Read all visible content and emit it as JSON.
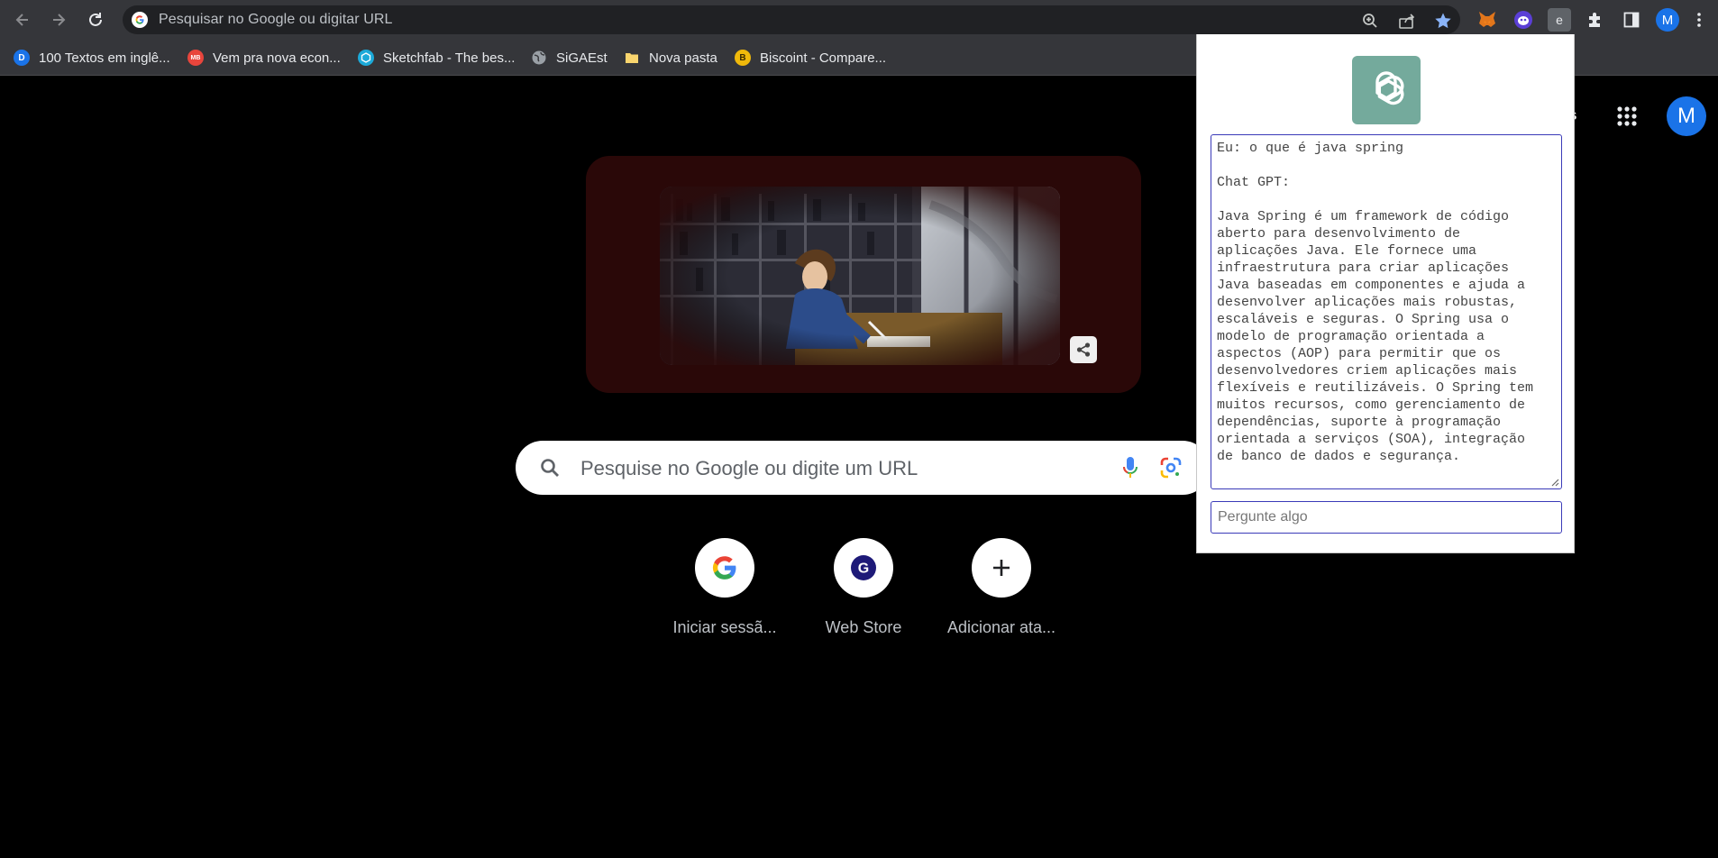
{
  "toolbar": {
    "omnibox_placeholder": "Pesquisar no Google ou digitar URL",
    "account_initial": "M"
  },
  "bookmarks": [
    {
      "label": "100 Textos em inglê...",
      "icon": "D",
      "color": "#1a73e8"
    },
    {
      "label": "Vem pra nova econ...",
      "icon": "MB",
      "color": "#e8453c"
    },
    {
      "label": "Sketchfab - The bes...",
      "icon": "sketchfab-icon",
      "color": "#1caad9"
    },
    {
      "label": "SiGAEst",
      "icon": "globe-icon",
      "color": "#9aa0a6"
    },
    {
      "label": "Nova pasta",
      "icon": "folder-icon",
      "color": "#f9d56e"
    },
    {
      "label": "Biscoint - Compare...",
      "icon": "B",
      "color": "#f0b90b"
    }
  ],
  "ntp": {
    "header_link_fragment": "s",
    "account_initial": "M",
    "search_placeholder": "Pesquise no Google ou digite um URL",
    "shortcuts": [
      {
        "label": "Iniciar sessã...",
        "icon": "google-g-icon"
      },
      {
        "label": "Web Store",
        "icon": "web-store-icon"
      },
      {
        "label": "Adicionar ata...",
        "icon": "plus-icon"
      }
    ]
  },
  "popup": {
    "chat_text": "Eu: o que é java spring\n\nChat GPT:\n\nJava Spring é um framework de código\naberto para desenvolvimento de\naplicações Java. Ele fornece uma\ninfraestrutura para criar aplicações\nJava baseadas em componentes e ajuda a\ndesenvolver aplicações mais robustas,\nescaláveis e seguras. O Spring usa o\nmodelo de programação orientada a\naspectos (AOP) para permitir que os\ndesenvolvedores criem aplicações mais\nflexíveis e reutilizáveis. O Spring tem\nmuitos recursos, como gerenciamento de\ndependências, suporte à programação\norientada a serviços (SOA), integração\nde banco de dados e segurança.",
    "ask_placeholder": "Pergunte algo"
  },
  "colors": {
    "toolbar_bg": "#35363a",
    "omnibox_bg": "#202124",
    "accent_blue": "#1a73e8",
    "chatgpt_green": "#74aa9c",
    "doodle_frame": "#2a0808"
  }
}
